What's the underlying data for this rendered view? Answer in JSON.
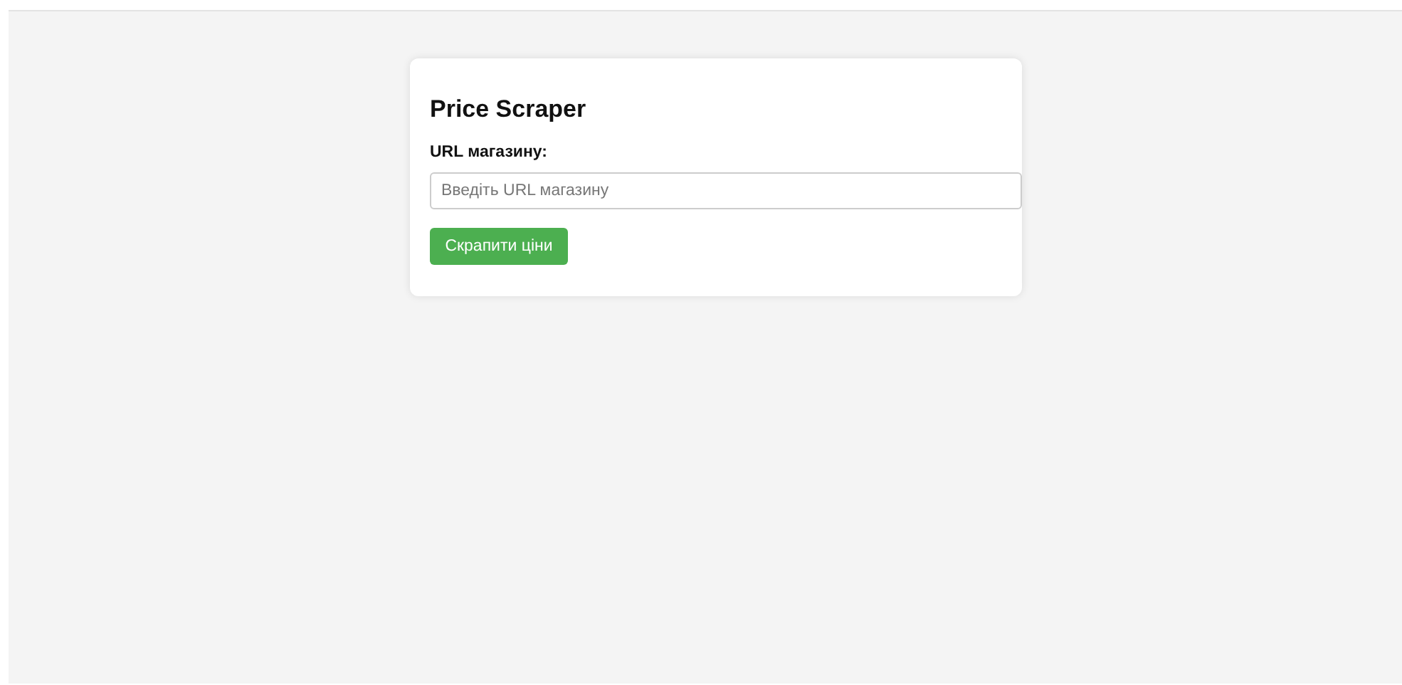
{
  "card": {
    "title": "Price Scraper",
    "url_field": {
      "label": "URL магазину:",
      "placeholder": "Введіть URL магазину"
    },
    "submit_button": {
      "label": "Скрапити ціни"
    }
  }
}
